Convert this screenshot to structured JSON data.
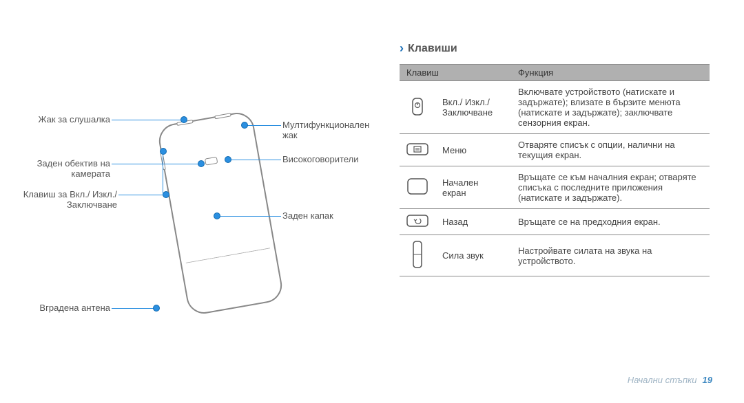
{
  "section_title": "Клавиши",
  "diagram_labels": {
    "left": [
      "Жак за слушалка",
      "Заден обектив на камерата",
      "Клавиш за Вкл./ Изкл./ Заключване",
      "Вградена антена"
    ],
    "right": [
      "Мултифункционален жак",
      "Високоговорители",
      "Заден капак"
    ]
  },
  "table": {
    "headers": [
      "Клавиш",
      "Функция"
    ],
    "rows": [
      {
        "icon": "power-key-icon",
        "label": "Вкл./ Изкл./ Заключване",
        "func": "Включвате устройството (натискате и задържате); влизате в бързите менюта (натискате и задържате); заключвате сензорния екран."
      },
      {
        "icon": "menu-key-icon",
        "label": "Меню",
        "func": "Отваряте списък с опции, налични на текущия екран."
      },
      {
        "icon": "home-key-icon",
        "label": "Начален екран",
        "func": "Връщате се към началния екран; отваряте списъка с последните приложения (натискате и задържате)."
      },
      {
        "icon": "back-key-icon",
        "label": "Назад",
        "func": "Връщате се на предходния екран."
      },
      {
        "icon": "volume-key-icon",
        "label": "Сила звук",
        "func": "Настройвате силата на звука на устройството."
      }
    ]
  },
  "footer": {
    "breadcrumb": "Начални стъпки",
    "page": "19"
  }
}
